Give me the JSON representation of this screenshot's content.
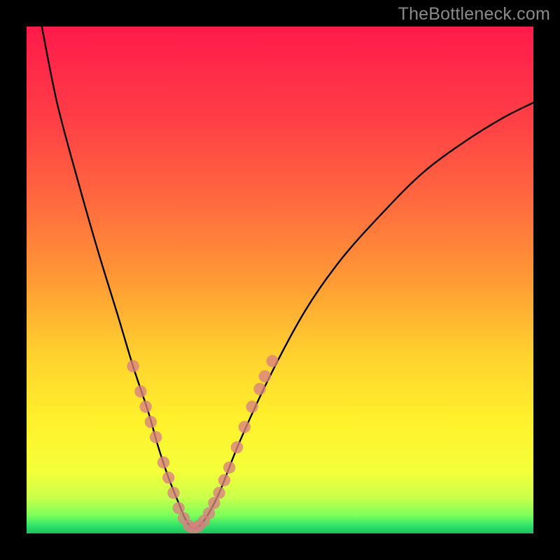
{
  "watermark": "TheBottleneck.com",
  "gradient_stops": [
    {
      "offset": 0.0,
      "color": "#ff1a4b"
    },
    {
      "offset": 0.18,
      "color": "#ff3e46"
    },
    {
      "offset": 0.35,
      "color": "#ff6b3e"
    },
    {
      "offset": 0.5,
      "color": "#ff9a35"
    },
    {
      "offset": 0.65,
      "color": "#ffd22e"
    },
    {
      "offset": 0.78,
      "color": "#fff22c"
    },
    {
      "offset": 0.88,
      "color": "#f3ff3a"
    },
    {
      "offset": 0.93,
      "color": "#c8ff4a"
    },
    {
      "offset": 0.965,
      "color": "#7aff5a"
    },
    {
      "offset": 0.985,
      "color": "#30e26a"
    },
    {
      "offset": 1.0,
      "color": "#17c55c"
    }
  ],
  "chart_data": {
    "type": "line",
    "title": "",
    "xlabel": "",
    "ylabel": "",
    "xlim": [
      0,
      100
    ],
    "ylim": [
      0,
      100
    ],
    "series": [
      {
        "name": "bottleneck-curve",
        "x": [
          3,
          6,
          10,
          14,
          18,
          21,
          24,
          26,
          28,
          30,
          31.5,
          33,
          35,
          38,
          42,
          48,
          55,
          62,
          70,
          78,
          86,
          94,
          100
        ],
        "y": [
          100,
          85,
          70,
          56,
          43,
          33,
          24,
          17,
          11,
          6,
          2.5,
          1,
          2.5,
          8,
          18,
          31,
          44,
          54,
          63,
          71,
          77,
          82,
          85
        ]
      }
    ],
    "markers": {
      "name": "highlighted-points",
      "color": "#d98082",
      "radius_plot_units": 1.2,
      "points": [
        {
          "x": 21.0,
          "y": 33.0
        },
        {
          "x": 22.5,
          "y": 28.0
        },
        {
          "x": 23.5,
          "y": 25.0
        },
        {
          "x": 24.5,
          "y": 22.0
        },
        {
          "x": 25.5,
          "y": 19.0
        },
        {
          "x": 27.0,
          "y": 14.0
        },
        {
          "x": 28.0,
          "y": 11.0
        },
        {
          "x": 29.0,
          "y": 8.0
        },
        {
          "x": 30.0,
          "y": 5.0
        },
        {
          "x": 31.0,
          "y": 3.0
        },
        {
          "x": 32.0,
          "y": 1.5
        },
        {
          "x": 33.0,
          "y": 1.0
        },
        {
          "x": 34.0,
          "y": 1.5
        },
        {
          "x": 35.0,
          "y": 2.5
        },
        {
          "x": 36.0,
          "y": 4.0
        },
        {
          "x": 37.0,
          "y": 6.0
        },
        {
          "x": 38.0,
          "y": 8.0
        },
        {
          "x": 39.0,
          "y": 10.5
        },
        {
          "x": 40.0,
          "y": 13.0
        },
        {
          "x": 41.5,
          "y": 17.0
        },
        {
          "x": 43.0,
          "y": 21.0
        },
        {
          "x": 44.5,
          "y": 25.0
        },
        {
          "x": 46.0,
          "y": 28.5
        },
        {
          "x": 47.0,
          "y": 31.0
        },
        {
          "x": 48.5,
          "y": 34.0
        }
      ]
    }
  }
}
